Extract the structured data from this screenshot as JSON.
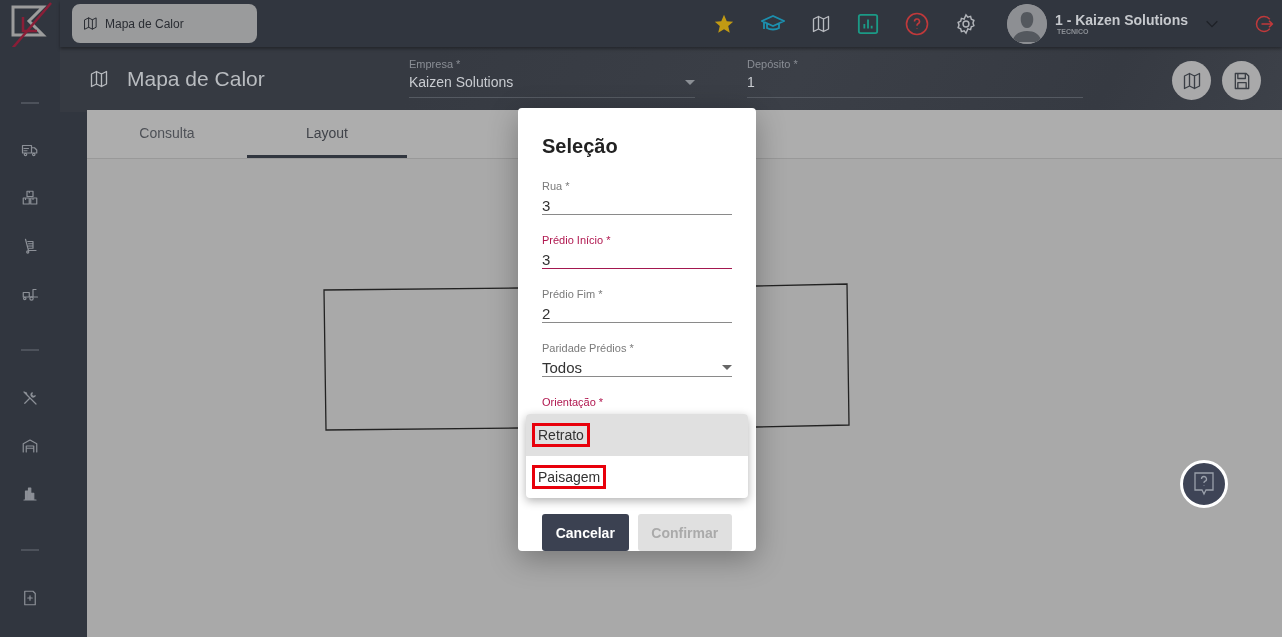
{
  "topbar": {
    "breadcrumb": "Mapa de Calor",
    "user_name": "1 - Kaizen Solutions",
    "user_role": "TECNICO"
  },
  "page": {
    "title": "Mapa de Calor",
    "fields": [
      {
        "label": "Empresa *",
        "value": "Kaizen Solutions",
        "kind": "select"
      },
      {
        "label": "Depósito *",
        "value": "1",
        "kind": "text"
      }
    ]
  },
  "tabs": [
    {
      "label": "Consulta",
      "selected": false
    },
    {
      "label": "Layout",
      "selected": true
    }
  ],
  "dialog": {
    "title": "Seleção",
    "fields": [
      {
        "label": "Rua *",
        "value": "3",
        "kind": "text",
        "focused": false
      },
      {
        "label": "Prédio Início *",
        "value": "3",
        "kind": "text",
        "focused": true
      },
      {
        "label": "Prédio Fim *",
        "value": "2",
        "kind": "text",
        "focused": false
      },
      {
        "label": "Paridade Prédios *",
        "value": "Todos",
        "kind": "select",
        "focused": false
      },
      {
        "label": "Orientação *",
        "kind": "select",
        "focused": true
      }
    ],
    "buttons": [
      {
        "label": "Cancelar",
        "disabled": false
      },
      {
        "label": "Confirmar",
        "disabled": true
      }
    ]
  },
  "dropdown": {
    "options": [
      {
        "label": "Retrato",
        "selected": true,
        "highlighted": true
      },
      {
        "label": "Paisagem",
        "selected": false,
        "highlighted": true
      }
    ]
  }
}
